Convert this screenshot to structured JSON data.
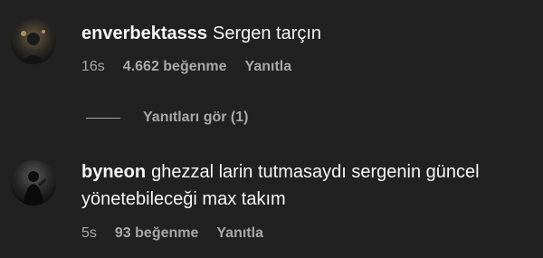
{
  "comments": [
    {
      "username": "enverbektasss",
      "text": "Sergen tarçın",
      "time": "16s",
      "likes": "4.662 beğenme",
      "reply_label": "Yanıtla",
      "avatar_icon": "user-avatar-photo"
    },
    {
      "username": "byneon",
      "text_line1": "ghezzal larin tutmasaydı sergenin güncel",
      "text_line2": "yönetebileceği max takım",
      "time": "5s",
      "likes": "93 beğenme",
      "reply_label": "Yanıtla",
      "avatar_icon": "user-avatar-photo"
    }
  ],
  "view_replies": {
    "label": "Yanıtları gör (1)"
  },
  "colors": {
    "background": "#212121",
    "primary_text": "#f5f5f5",
    "secondary_text": "#a8a8a8"
  }
}
